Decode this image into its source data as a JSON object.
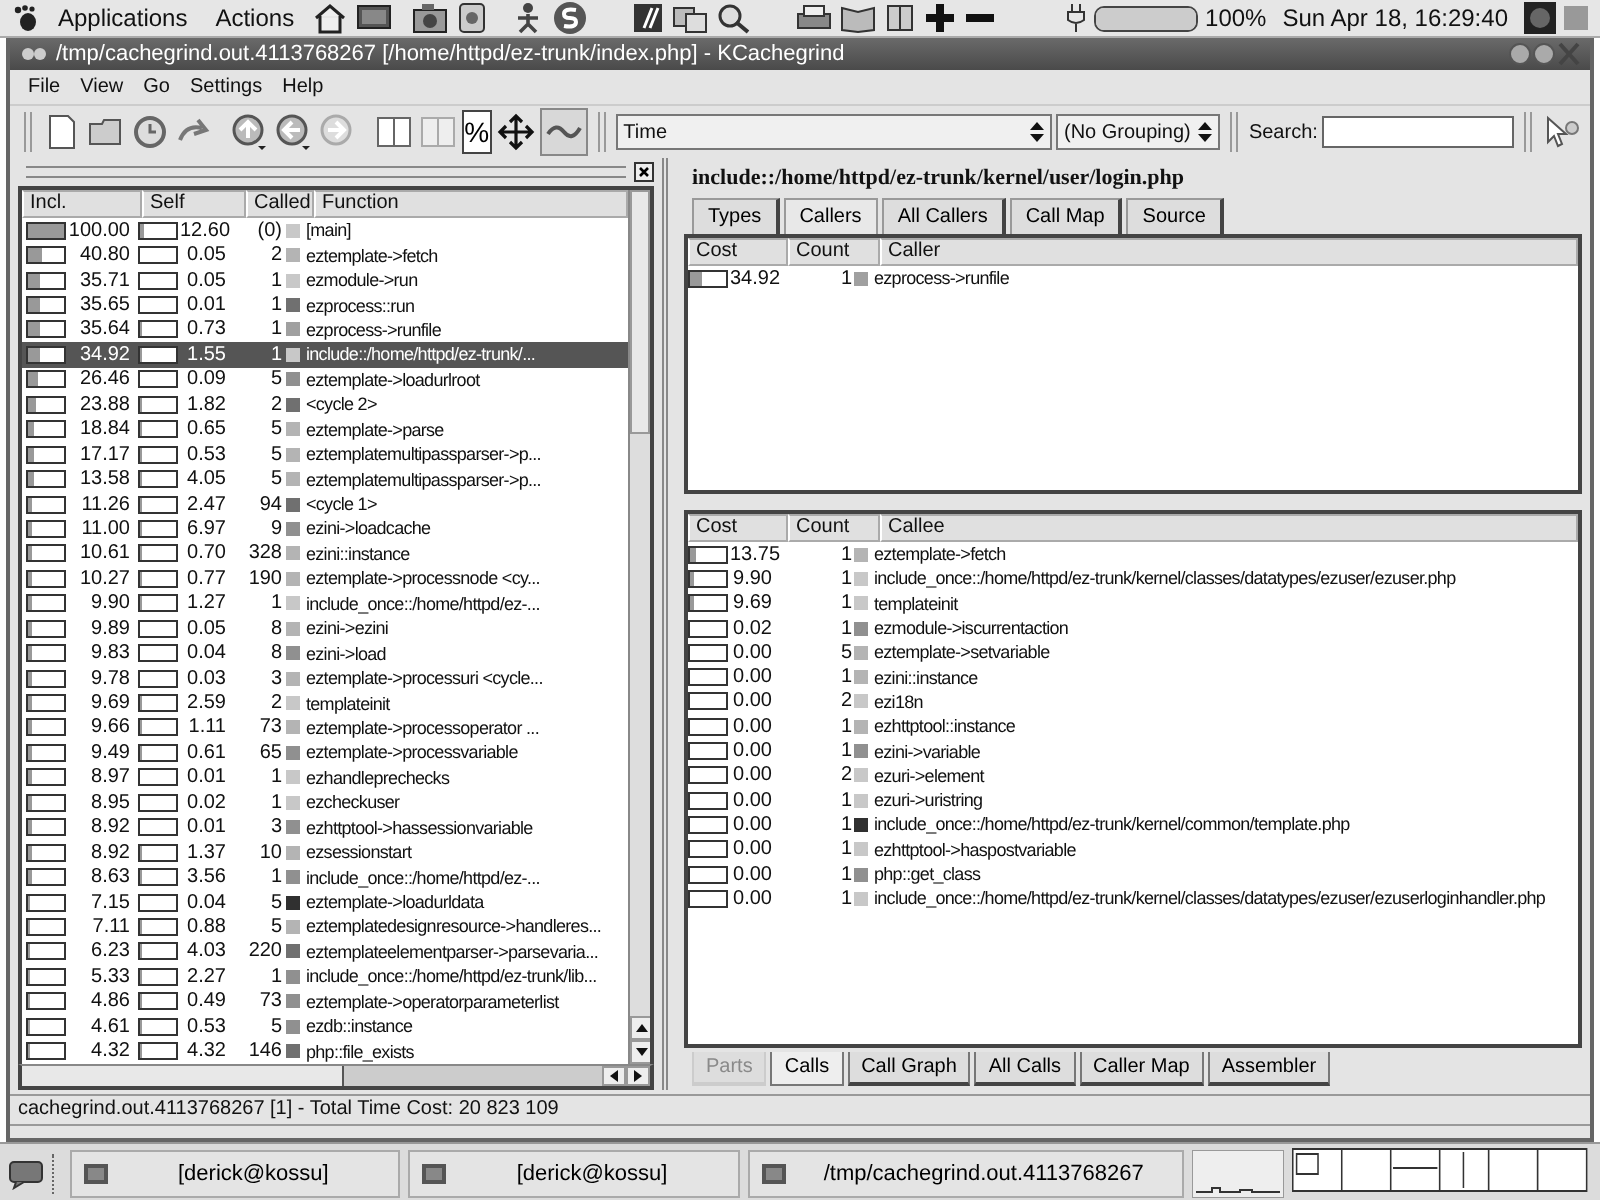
{
  "top_panel": {
    "menus": [
      "Applications",
      "Actions"
    ],
    "battery": {
      "level": 1.0
    },
    "battery_text": "100%",
    "clock": "Sun Apr 18, 16:29:40"
  },
  "window": {
    "title": "/tmp/cachegrind.out.4113768267 [/home/httpd/ez-trunk/index.php] - KCachegrind"
  },
  "menu": [
    "File",
    "View",
    "Go",
    "Settings",
    "Help"
  ],
  "toolbar": {
    "percent": {
      "label": "%",
      "selected": true
    },
    "event_type": "Time",
    "grouping": "(No Grouping)",
    "search_label": "Search:"
  },
  "function_list": {
    "columns": [
      "Incl.",
      "Self",
      "Called",
      "Function"
    ],
    "rows": [
      {
        "incl": {
          "value": "100.00",
          "level": 1.0
        },
        "self": {
          "value": "12.60",
          "level": 0.126
        },
        "called": "(0)",
        "name": "[main]",
        "color": "#c8c8c8",
        "selected": false
      },
      {
        "incl": {
          "value": "40.80",
          "level": 0.408
        },
        "self": {
          "value": "0.05",
          "level": 0.0
        },
        "called": "2",
        "name": "eztemplate->fetch",
        "color": "#b4b4b4",
        "selected": false
      },
      {
        "incl": {
          "value": "35.71",
          "level": 0.357
        },
        "self": {
          "value": "0.05",
          "level": 0.0
        },
        "called": "1",
        "name": "ezmodule->run",
        "color": "#c8c8c8",
        "selected": false
      },
      {
        "incl": {
          "value": "35.65",
          "level": 0.356
        },
        "self": {
          "value": "0.01",
          "level": 0.0
        },
        "called": "1",
        "name": "ezprocess::run",
        "color": "#707070",
        "selected": false
      },
      {
        "incl": {
          "value": "35.64",
          "level": 0.356
        },
        "self": {
          "value": "0.73",
          "level": 0.007
        },
        "called": "1",
        "name": "ezprocess->runfile",
        "color": "#a0a0a0",
        "selected": false
      },
      {
        "incl": {
          "value": "34.92",
          "level": 0.349
        },
        "self": {
          "value": "1.55",
          "level": 0.015
        },
        "called": "1",
        "name": "include::/home/httpd/ez-trunk/...",
        "color": "#c8c8c8",
        "selected": true
      },
      {
        "incl": {
          "value": "26.46",
          "level": 0.265
        },
        "self": {
          "value": "0.09",
          "level": 0.0
        },
        "called": "5",
        "name": "eztemplate->loadurlroot",
        "color": "#909090",
        "selected": false
      },
      {
        "incl": {
          "value": "23.88",
          "level": 0.239
        },
        "self": {
          "value": "1.82",
          "level": 0.018
        },
        "called": "2",
        "name": "<cycle 2>",
        "color": "#707070",
        "selected": false
      },
      {
        "incl": {
          "value": "18.84",
          "level": 0.188
        },
        "self": {
          "value": "0.65",
          "level": 0.006
        },
        "called": "5",
        "name": "eztemplate->parse",
        "color": "#b4b4b4",
        "selected": false
      },
      {
        "incl": {
          "value": "17.17",
          "level": 0.172
        },
        "self": {
          "value": "0.53",
          "level": 0.005
        },
        "called": "5",
        "name": "eztemplatemultipassparser->p...",
        "color": "#b4b4b4",
        "selected": false
      },
      {
        "incl": {
          "value": "13.58",
          "level": 0.136
        },
        "self": {
          "value": "4.05",
          "level": 0.04
        },
        "called": "5",
        "name": "eztemplatemultipassparser->p...",
        "color": "#b4b4b4",
        "selected": false
      },
      {
        "incl": {
          "value": "11.26",
          "level": 0.113
        },
        "self": {
          "value": "2.47",
          "level": 0.025
        },
        "called": "94",
        "name": "<cycle 1>",
        "color": "#707070",
        "selected": false
      },
      {
        "incl": {
          "value": "11.00",
          "level": 0.11
        },
        "self": {
          "value": "6.97",
          "level": 0.07
        },
        "called": "9",
        "name": "ezini->loadcache",
        "color": "#909090",
        "selected": false
      },
      {
        "incl": {
          "value": "10.61",
          "level": 0.106
        },
        "self": {
          "value": "0.70",
          "level": 0.007
        },
        "called": "328",
        "name": "ezini::instance",
        "color": "#b4b4b4",
        "selected": false
      },
      {
        "incl": {
          "value": "10.27",
          "level": 0.103
        },
        "self": {
          "value": "0.77",
          "level": 0.008
        },
        "called": "190",
        "name": "eztemplate->processnode <cy...",
        "color": "#b4b4b4",
        "selected": false
      },
      {
        "incl": {
          "value": "9.90",
          "level": 0.099
        },
        "self": {
          "value": "1.27",
          "level": 0.013
        },
        "called": "1",
        "name": "include_once::/home/httpd/ez-...",
        "color": "#c8c8c8",
        "selected": false
      },
      {
        "incl": {
          "value": "9.89",
          "level": 0.099
        },
        "self": {
          "value": "0.05",
          "level": 0.0
        },
        "called": "8",
        "name": "ezini->ezini",
        "color": "#b4b4b4",
        "selected": false
      },
      {
        "incl": {
          "value": "9.83",
          "level": 0.098
        },
        "self": {
          "value": "0.04",
          "level": 0.0
        },
        "called": "8",
        "name": "ezini->load",
        "color": "#909090",
        "selected": false
      },
      {
        "incl": {
          "value": "9.78",
          "level": 0.098
        },
        "self": {
          "value": "0.03",
          "level": 0.0
        },
        "called": "3",
        "name": "eztemplate->processuri <cycle...",
        "color": "#b4b4b4",
        "selected": false
      },
      {
        "incl": {
          "value": "9.69",
          "level": 0.097
        },
        "self": {
          "value": "2.59",
          "level": 0.026
        },
        "called": "2",
        "name": "templateinit",
        "color": "#c8c8c8",
        "selected": false
      },
      {
        "incl": {
          "value": "9.66",
          "level": 0.097
        },
        "self": {
          "value": "1.11",
          "level": 0.011
        },
        "called": "73",
        "name": "eztemplate->processoperator ...",
        "color": "#b4b4b4",
        "selected": false
      },
      {
        "incl": {
          "value": "9.49",
          "level": 0.095
        },
        "self": {
          "value": "0.61",
          "level": 0.006
        },
        "called": "65",
        "name": "eztemplate->processvariable",
        "color": "#909090",
        "selected": false
      },
      {
        "incl": {
          "value": "8.97",
          "level": 0.09
        },
        "self": {
          "value": "0.01",
          "level": 0.0
        },
        "called": "1",
        "name": "ezhandleprechecks",
        "color": "#c8c8c8",
        "selected": false
      },
      {
        "incl": {
          "value": "8.95",
          "level": 0.09
        },
        "self": {
          "value": "0.02",
          "level": 0.0
        },
        "called": "1",
        "name": "ezcheckuser",
        "color": "#c8c8c8",
        "selected": false
      },
      {
        "incl": {
          "value": "8.92",
          "level": 0.089
        },
        "self": {
          "value": "0.01",
          "level": 0.0
        },
        "called": "3",
        "name": "ezhttptool->hassessionvariable",
        "color": "#909090",
        "selected": false
      },
      {
        "incl": {
          "value": "8.92",
          "level": 0.089
        },
        "self": {
          "value": "1.37",
          "level": 0.014
        },
        "called": "10",
        "name": "ezsessionstart",
        "color": "#b4b4b4",
        "selected": false
      },
      {
        "incl": {
          "value": "8.63",
          "level": 0.086
        },
        "self": {
          "value": "3.56",
          "level": 0.036
        },
        "called": "1",
        "name": "include_once::/home/httpd/ez-...",
        "color": "#909090",
        "selected": false
      },
      {
        "incl": {
          "value": "7.15",
          "level": 0.072
        },
        "self": {
          "value": "0.04",
          "level": 0.0
        },
        "called": "5",
        "name": "eztemplate->loadurldata",
        "color": "#303030",
        "selected": false
      },
      {
        "incl": {
          "value": "7.11",
          "level": 0.071
        },
        "self": {
          "value": "0.88",
          "level": 0.009
        },
        "called": "5",
        "name": "eztemplatedesignresource->handleres...",
        "color": "#b4b4b4",
        "selected": false
      },
      {
        "incl": {
          "value": "6.23",
          "level": 0.062
        },
        "self": {
          "value": "4.03",
          "level": 0.04
        },
        "called": "220",
        "name": "eztemplateelementparser->parsevaria...",
        "color": "#707070",
        "selected": false
      },
      {
        "incl": {
          "value": "5.33",
          "level": 0.053
        },
        "self": {
          "value": "2.27",
          "level": 0.023
        },
        "called": "1",
        "name": "include_once::/home/httpd/ez-trunk/lib...",
        "color": "#909090",
        "selected": false
      },
      {
        "incl": {
          "value": "4.86",
          "level": 0.049
        },
        "self": {
          "value": "0.49",
          "level": 0.005
        },
        "called": "73",
        "name": "eztemplate->operatorparameterlist",
        "color": "#909090",
        "selected": false
      },
      {
        "incl": {
          "value": "4.61",
          "level": 0.046
        },
        "self": {
          "value": "0.53",
          "level": 0.005
        },
        "called": "5",
        "name": "ezdb::instance",
        "color": "#909090",
        "selected": false
      },
      {
        "incl": {
          "value": "4.32",
          "level": 0.043
        },
        "self": {
          "value": "4.32",
          "level": 0.043
        },
        "called": "146",
        "name": "php::file_exists",
        "color": "#707070",
        "selected": false
      }
    ]
  },
  "detail": {
    "title": "include::/home/httpd/ez-trunk/kernel/user/login.php",
    "tabs": [
      {
        "label": "Types",
        "selected": false
      },
      {
        "label": "Callers",
        "selected": true
      },
      {
        "label": "All Callers",
        "selected": false
      },
      {
        "label": "Call Map",
        "selected": false
      },
      {
        "label": "Source",
        "selected": false
      }
    ],
    "callers": {
      "columns": [
        "Cost",
        "Count",
        "Caller"
      ],
      "rows": [
        {
          "cost": {
            "value": "34.92",
            "level": 0.349
          },
          "count": "1",
          "name": "ezprocess->runfile",
          "color": "#a0a0a0"
        }
      ]
    },
    "callees": {
      "columns": [
        "Cost",
        "Count",
        "Callee"
      ],
      "rows": [
        {
          "cost": {
            "value": "13.75",
            "level": 0.138
          },
          "count": "1",
          "name": "eztemplate->fetch",
          "color": "#b4b4b4"
        },
        {
          "cost": {
            "value": "9.90",
            "level": 0.099
          },
          "count": "1",
          "name": "include_once::/home/httpd/ez-trunk/kernel/classes/datatypes/ezuser/ezuser.php",
          "color": "#c8c8c8"
        },
        {
          "cost": {
            "value": "9.69",
            "level": 0.097
          },
          "count": "1",
          "name": "templateinit",
          "color": "#c8c8c8"
        },
        {
          "cost": {
            "value": "0.02",
            "level": 0.0
          },
          "count": "1",
          "name": "ezmodule->iscurrentaction",
          "color": "#909090"
        },
        {
          "cost": {
            "value": "0.00",
            "level": 0.0
          },
          "count": "5",
          "name": "eztemplate->setvariable",
          "color": "#b4b4b4"
        },
        {
          "cost": {
            "value": "0.00",
            "level": 0.0
          },
          "count": "1",
          "name": "ezini::instance",
          "color": "#b4b4b4"
        },
        {
          "cost": {
            "value": "0.00",
            "level": 0.0
          },
          "count": "2",
          "name": "ezi18n",
          "color": "#c8c8c8"
        },
        {
          "cost": {
            "value": "0.00",
            "level": 0.0
          },
          "count": "1",
          "name": "ezhttptool::instance",
          "color": "#b4b4b4"
        },
        {
          "cost": {
            "value": "0.00",
            "level": 0.0
          },
          "count": "1",
          "name": "ezini->variable",
          "color": "#909090"
        },
        {
          "cost": {
            "value": "0.00",
            "level": 0.0
          },
          "count": "2",
          "name": "ezuri->element",
          "color": "#c8c8c8"
        },
        {
          "cost": {
            "value": "0.00",
            "level": 0.0
          },
          "count": "1",
          "name": "ezuri->uristring",
          "color": "#c8c8c8"
        },
        {
          "cost": {
            "value": "0.00",
            "level": 0.0
          },
          "count": "1",
          "name": "include_once::/home/httpd/ez-trunk/kernel/common/template.php",
          "color": "#303030"
        },
        {
          "cost": {
            "value": "0.00",
            "level": 0.0
          },
          "count": "1",
          "name": "ezhttptool->haspostvariable",
          "color": "#c8c8c8"
        },
        {
          "cost": {
            "value": "0.00",
            "level": 0.0
          },
          "count": "1",
          "name": "php::get_class",
          "color": "#909090"
        },
        {
          "cost": {
            "value": "0.00",
            "level": 0.0
          },
          "count": "1",
          "name": "include_once::/home/httpd/ez-trunk/kernel/classes/datatypes/ezuser/ezuserloginhandler.php",
          "color": "#c8c8c8"
        }
      ]
    },
    "bottom_tabs": [
      {
        "label": "Parts",
        "selected": false,
        "disabled": true
      },
      {
        "label": "Calls",
        "selected": true,
        "disabled": false
      },
      {
        "label": "Call Graph",
        "selected": false,
        "disabled": false
      },
      {
        "label": "All Calls",
        "selected": false,
        "disabled": false
      },
      {
        "label": "Caller Map",
        "selected": false,
        "disabled": false
      },
      {
        "label": "Assembler",
        "selected": false,
        "disabled": false
      }
    ]
  },
  "status_bar": "cachegrind.out.4113768267 [1] - Total Time Cost:  20 823 109",
  "taskbar": {
    "tasks": [
      {
        "label": "[derick@kossu]"
      },
      {
        "label": "[derick@kossu]"
      },
      {
        "label": "/tmp/cachegrind.out.4113768267"
      }
    ]
  }
}
